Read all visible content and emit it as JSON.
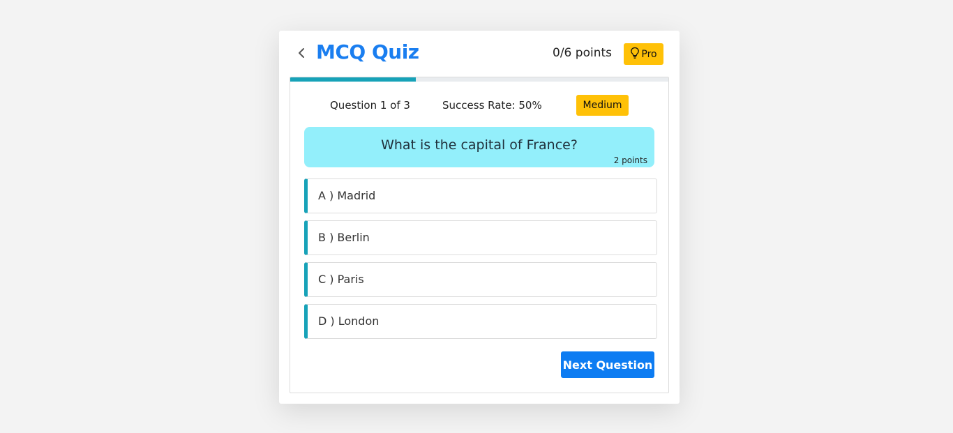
{
  "header": {
    "title": "MCQ Quiz",
    "score": "0/6 points",
    "pro_label": "Pro"
  },
  "progress": {
    "value": 0.333
  },
  "meta": {
    "question_counter": "Question 1 of 3",
    "success_rate": "Success Rate: 50%",
    "difficulty": "Medium"
  },
  "question": {
    "text": "What is the capital of France?",
    "points": "2 points"
  },
  "options": [
    {
      "label": "A ) Madrid"
    },
    {
      "label": "B ) Berlin"
    },
    {
      "label": "C ) Paris"
    },
    {
      "label": "D ) London"
    }
  ],
  "actions": {
    "next_label": "Next Question"
  },
  "colors": {
    "primary": "#1a7ef0",
    "accent": "#17a2b8",
    "warning": "#ffc107",
    "question_bg": "#93effb",
    "button_bg": "#0d7cf2"
  },
  "icons": {
    "back": "chevron-left-icon",
    "pro": "lightbulb-icon"
  }
}
